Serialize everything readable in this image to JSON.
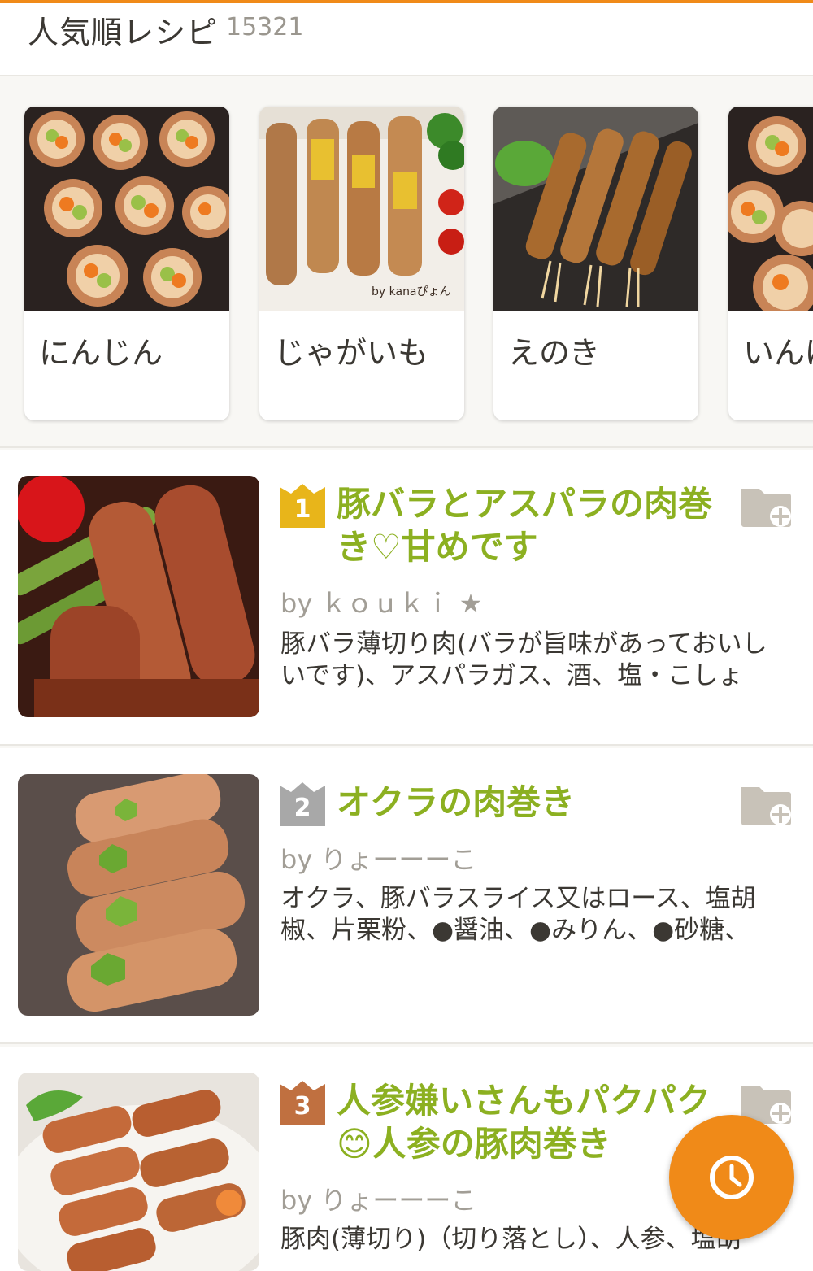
{
  "header": {
    "title": "人気順レシピ",
    "count": "15321"
  },
  "categories": [
    {
      "label": "にんじん"
    },
    {
      "label": "じゃがいも",
      "photo_credit": "by kanaぴょん"
    },
    {
      "label": "えのき"
    },
    {
      "label": "いんげん"
    }
  ],
  "recipes": [
    {
      "rank": "1",
      "title": "豚バラとアスパラの肉巻き♡甘めです",
      "author": "by ｋｏｕｋｉ ★",
      "ingredients": "豚バラ薄切り肉(バラが旨味があっておいしいです)、アスパラガス、酒、塩・こしょ"
    },
    {
      "rank": "2",
      "title": "オクラの肉巻き",
      "author": "by りょーーーこ",
      "ingredients": "オクラ、豚バラスライス又はロース、塩胡椒、片栗粉、●醤油、●みりん、●砂糖、"
    },
    {
      "rank": "3",
      "title": "人参嫌いさんもパクパク😊人参の豚肉巻き",
      "author": "by りょーーーこ",
      "ingredients": "豚肉(薄切り)（切り落とし）、人参、塩胡"
    }
  ],
  "colors": {
    "accent": "#f08a18",
    "title_green": "#8cb021",
    "rank_gold": "#e8b51a",
    "rank_silver": "#a8a8a8",
    "rank_bronze": "#c07040"
  },
  "icons": {
    "folder_add": "folder-add-icon",
    "history": "clock-icon"
  }
}
